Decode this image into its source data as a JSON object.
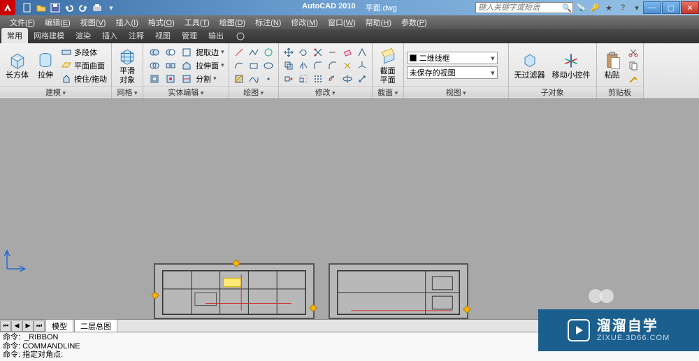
{
  "title": {
    "app": "AutoCAD 2010",
    "doc": "平面.dwg"
  },
  "search": {
    "placeholder": "键入关键字或短语"
  },
  "menus": [
    {
      "t": "文件",
      "u": "F"
    },
    {
      "t": "编辑",
      "u": "E"
    },
    {
      "t": "视图",
      "u": "V"
    },
    {
      "t": "插入",
      "u": "I"
    },
    {
      "t": "格式",
      "u": "O"
    },
    {
      "t": "工具",
      "u": "T"
    },
    {
      "t": "绘图",
      "u": "D"
    },
    {
      "t": "标注",
      "u": "N"
    },
    {
      "t": "修改",
      "u": "M"
    },
    {
      "t": "窗口",
      "u": "W"
    },
    {
      "t": "帮助",
      "u": "H"
    },
    {
      "t": "参数",
      "u": "P"
    }
  ],
  "ribbon_tabs": [
    "常用",
    "网格建模",
    "渲染",
    "插入",
    "注释",
    "视图",
    "管理",
    "输出"
  ],
  "ribbon_active": 0,
  "panels": {
    "model": {
      "label": "建模",
      "big": [
        {
          "n": "box",
          "t": "长方体"
        },
        {
          "n": "extrude",
          "t": "拉伸"
        }
      ],
      "rows": [
        {
          "icon": "polysolid",
          "t": "多段体"
        },
        {
          "icon": "planarsurf",
          "t": "平面曲面"
        },
        {
          "icon": "presspull",
          "t": "按住/拖动"
        }
      ]
    },
    "mesh": {
      "label": "网格",
      "big": [
        {
          "n": "smooth",
          "t": "平滑\n对象"
        }
      ]
    },
    "solid": {
      "label": "实体编辑",
      "rows": [
        {
          "items": [
            "union-icon",
            "subtract-icon",
            "extract-edges",
            "extract-edges2"
          ],
          "t": "提取边"
        },
        {
          "items": [
            "intersect-icon",
            "separate-icon",
            "extrude-face",
            "extrude-face2"
          ],
          "t": "拉伸面"
        },
        {
          "items": [
            "shell-icon",
            "imprint-icon",
            "slice-icon",
            "slice2-icon"
          ],
          "t": "分割"
        }
      ]
    },
    "draw": {
      "label": "绘图"
    },
    "modify": {
      "label": "修改"
    },
    "section": {
      "label": "截面",
      "big": [
        {
          "n": "section",
          "t": "截面\n平面"
        }
      ]
    },
    "view": {
      "label": "视图",
      "combos": [
        {
          "swatch": true,
          "t": "二维线框"
        },
        {
          "swatch": false,
          "t": "未保存的视图"
        }
      ]
    },
    "subobj": {
      "label": "子对象",
      "big": [
        {
          "n": "nofilter",
          "t": "无过滤器"
        },
        {
          "n": "gizmo",
          "t": "移动小控件"
        }
      ]
    },
    "clipboard": {
      "label": "剪贴板",
      "big": [
        {
          "n": "paste",
          "t": "粘贴"
        }
      ]
    }
  },
  "model_tabs": [
    "模型",
    "二层总图"
  ],
  "cmd_lines": [
    "命令:  _RIBBON",
    "命令: COMMANDLINE",
    "命令: 指定对角点:"
  ],
  "watermark": {
    "cn": "溜溜自学",
    "en": "ZIXUE.3D66.COM"
  }
}
